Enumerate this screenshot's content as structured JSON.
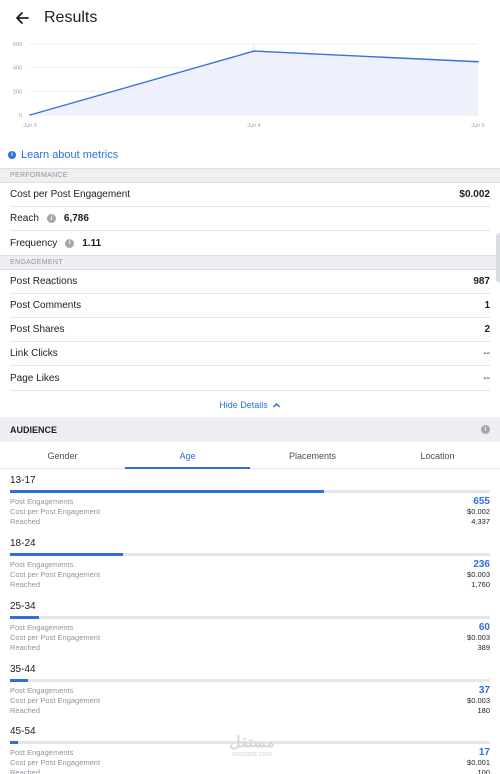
{
  "header": {
    "title": "Results"
  },
  "chart_data": {
    "type": "area",
    "x": [
      "Jun 3",
      "Jun 4",
      "Jun 5"
    ],
    "series": [
      {
        "values": [
          0,
          540,
          450
        ]
      }
    ],
    "yticks": [
      "0",
      "200",
      "400",
      "600"
    ],
    "ylim": [
      0,
      600
    ],
    "color": "#3b6fd8",
    "fill": "#eef0fb",
    "grid": true
  },
  "learn_link": "Learn about metrics",
  "performance": {
    "header": "PERFORMANCE",
    "cost_label": "Cost per Post Engagement",
    "cost_value": "$0.002",
    "reach_label": "Reach",
    "reach_value": "6,786",
    "frequency_label": "Frequency",
    "frequency_value": "1.11"
  },
  "engagement": {
    "header": "ENGAGEMENT",
    "rows": [
      {
        "label": "Post Reactions",
        "value": "987"
      },
      {
        "label": "Post Comments",
        "value": "1"
      },
      {
        "label": "Post Shares",
        "value": "2"
      },
      {
        "label": "Link Clicks",
        "value": "--"
      },
      {
        "label": "Page Likes",
        "value": "--"
      }
    ]
  },
  "hide_details": "Hide Details",
  "audience": {
    "header": "AUDIENCE",
    "tabs": [
      "Gender",
      "Age",
      "Placements",
      "Location"
    ],
    "active_tab": "Age",
    "metric_labels": {
      "engagements": "Post Engagements",
      "cost": "Cost per Post Engagement",
      "reached": "Reached"
    },
    "groups": [
      {
        "age": "13-17",
        "engagements": "655",
        "cost": "$0.002",
        "reached": "4,337",
        "share": 0.655
      },
      {
        "age": "18-24",
        "engagements": "236",
        "cost": "$0.003",
        "reached": "1,760",
        "share": 0.236
      },
      {
        "age": "25-34",
        "engagements": "60",
        "cost": "$0.003",
        "reached": "389",
        "share": 0.06
      },
      {
        "age": "35-44",
        "engagements": "37",
        "cost": "$0.003",
        "reached": "180",
        "share": 0.037
      },
      {
        "age": "45-54",
        "engagements": "17",
        "cost": "$0.001",
        "reached": "100",
        "share": 0.017
      }
    ]
  },
  "watermark": {
    "line1": "مستقل",
    "line2": "mostaql.com"
  }
}
